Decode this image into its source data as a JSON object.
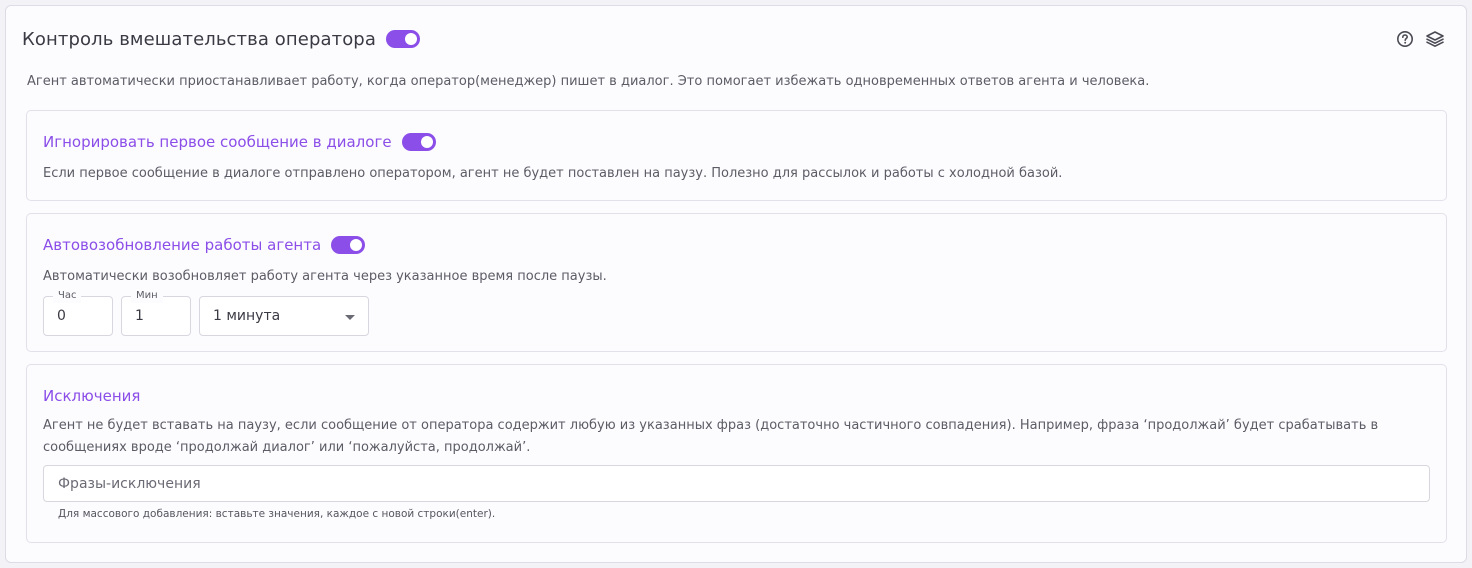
{
  "colors": {
    "accent": "#8b4ee8",
    "toggle_on": "#8b4ee8"
  },
  "header": {
    "title": "Контроль вмешательства оператора",
    "toggle_on": true,
    "icons": [
      "help-circle-icon",
      "layers-icon"
    ]
  },
  "description": "Агент автоматически приостанавливает работу, когда оператор(менеджер) пишет в диалог. Это помогает избежать одновременных ответов агента и человека.",
  "ignore_first": {
    "title": "Игнорировать первое сообщение в диалоге",
    "toggle_on": true,
    "text": "Если первое сообщение в диалоге отправлено оператором, агент не будет поставлен на паузу. Полезно для рассылок и работы с холодной базой."
  },
  "auto_resume": {
    "title": "Автовозобновление работы агента",
    "toggle_on": true,
    "text": "Автоматически возобновляет работу агента через указанное время после паузы.",
    "hours_label": "Час",
    "hours_value": "0",
    "minutes_label": "Мин",
    "minutes_value": "1",
    "preset_value": "1 минута"
  },
  "exceptions": {
    "title": "Исключения",
    "text_line1": "Агент не будет вставать на паузу, если сообщение от оператора содержит любую из указанных фраз (достаточно частичного совпадения). Например, фраза ‘продолжай’ будет срабатывать в",
    "text_line2": "сообщениях вроде ‘продолжай диалог’ или ‘пожалуйста, продолжай’.",
    "input_placeholder": "Фразы-исключения",
    "hint": "Для массового добавления: вставьте значения, каждое с новой строки(enter)."
  }
}
